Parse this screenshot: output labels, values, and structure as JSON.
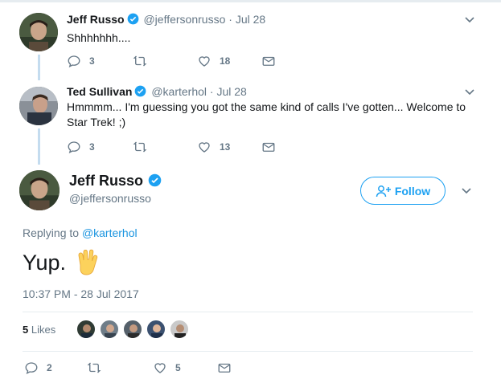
{
  "tweets": [
    {
      "name": "Jeff Russo",
      "handle": "@jeffersonrusso",
      "dot": "·",
      "time": "Jul 28",
      "text": "Shhhhhhh....",
      "replies": "3",
      "retweets": "",
      "likes": "18"
    },
    {
      "name": "Ted Sullivan",
      "handle": "@karterhol",
      "dot": "·",
      "time": "Jul 28",
      "text": "Hmmmm... I'm guessing you got the same kind of calls I've gotten... Welcome to Star Trek! ;)",
      "replies": "3",
      "retweets": "",
      "likes": "13"
    }
  ],
  "main": {
    "name": "Jeff Russo",
    "handle": "@jeffersonrusso",
    "follow_label": "Follow",
    "replying_prefix": "Replying to",
    "replying_to": "@karterhol",
    "text": "Yup.",
    "timestamp": "10:37 PM - 28 Jul 2017",
    "likes_count": "5",
    "likes_label": "Likes",
    "replies": "2",
    "retweets": "",
    "likes": "5"
  },
  "colors": {
    "accent": "#1da1f2",
    "secondary_text": "#657786",
    "thread_line": "#c4dcef",
    "divider": "#e6ecf0"
  },
  "icons": [
    "verified-badge-icon",
    "chevron-down-icon",
    "reply-icon",
    "retweet-icon",
    "like-heart-icon",
    "direct-message-icon",
    "follow-person-plus-icon",
    "vulcan-salute-emoji"
  ]
}
